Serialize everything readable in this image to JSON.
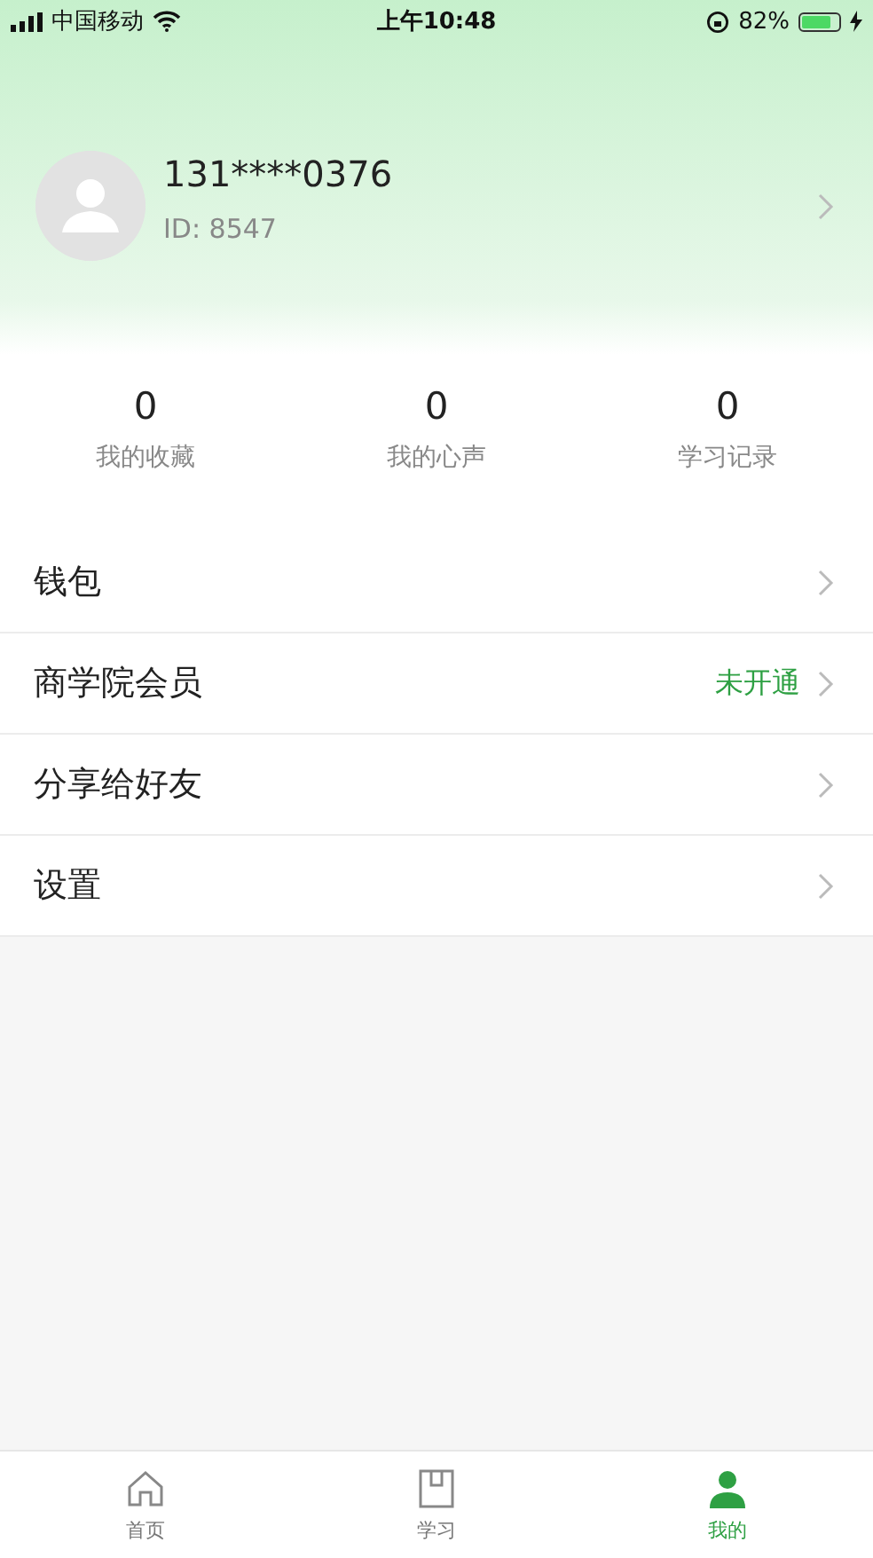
{
  "status_bar": {
    "carrier": "中国移动",
    "time": "上午10:48",
    "battery_text": "82%"
  },
  "profile": {
    "name": "131****0376",
    "id_text": "ID: 8547"
  },
  "stats": [
    {
      "value": "0",
      "label": "我的收藏"
    },
    {
      "value": "0",
      "label": "我的心声"
    },
    {
      "value": "0",
      "label": "学习记录"
    }
  ],
  "menu": [
    {
      "label": "钱包"
    },
    {
      "label": "商学院会员",
      "status": "未开通"
    },
    {
      "label": "分享给好友"
    },
    {
      "label": "设置"
    }
  ],
  "tabs": [
    {
      "label": "首页",
      "kind": "home",
      "selected": false
    },
    {
      "label": "学习",
      "kind": "book",
      "selected": false
    },
    {
      "label": "我的",
      "kind": "person",
      "selected": true
    }
  ]
}
